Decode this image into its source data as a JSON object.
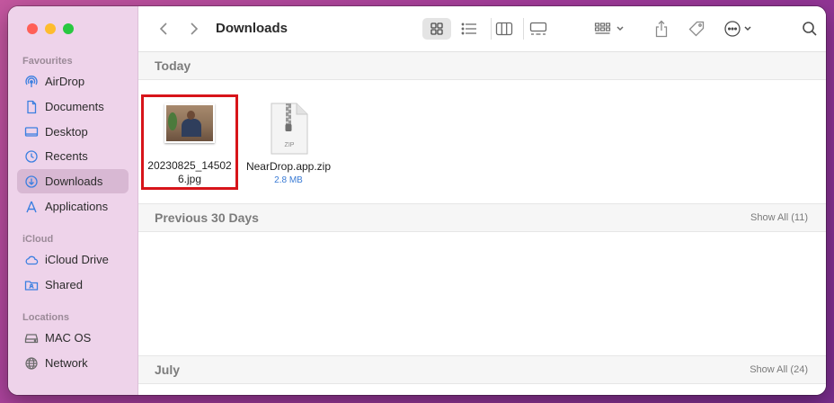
{
  "window": {
    "title": "Downloads"
  },
  "traffic_lights": {
    "close_color": "#ff5f57",
    "minimize_color": "#febc2e",
    "zoom_color": "#28c840"
  },
  "sidebar": {
    "sections": [
      {
        "label": "Favourites",
        "items": [
          {
            "label": "AirDrop",
            "icon": "airdrop-icon"
          },
          {
            "label": "Documents",
            "icon": "document-icon"
          },
          {
            "label": "Desktop",
            "icon": "desktop-icon"
          },
          {
            "label": "Recents",
            "icon": "clock-icon"
          },
          {
            "label": "Downloads",
            "icon": "download-icon",
            "selected": true
          },
          {
            "label": "Applications",
            "icon": "applications-icon"
          }
        ]
      },
      {
        "label": "iCloud",
        "items": [
          {
            "label": "iCloud Drive",
            "icon": "cloud-icon"
          },
          {
            "label": "Shared",
            "icon": "shared-folder-icon"
          }
        ]
      },
      {
        "label": "Locations",
        "items": [
          {
            "label": "MAC OS",
            "icon": "disk-icon"
          },
          {
            "label": "Network",
            "icon": "globe-icon"
          }
        ]
      }
    ]
  },
  "toolbar": {
    "buttons": [
      "back-icon",
      "forward-icon",
      "icon-view-icon",
      "list-view-icon",
      "column-view-icon",
      "gallery-view-icon",
      "group-by-icon",
      "share-icon",
      "tag-icon",
      "more-actions-icon",
      "search-icon"
    ]
  },
  "groups": [
    {
      "title": "Today",
      "files": [
        {
          "name": "20230825_145026.jpg",
          "name_line1": "20230825_14502",
          "name_line2": "6.jpg",
          "type": "image",
          "highlighted": true
        },
        {
          "name": "NearDrop.app.zip",
          "size": "2.8 MB",
          "type": "zip",
          "icon_label": "ZIP"
        }
      ]
    },
    {
      "title": "Previous 30 Days",
      "show_all": "Show All (11)"
    },
    {
      "title": "July",
      "show_all": "Show All (24)"
    }
  ],
  "colors": {
    "accent_selection": "#d8b8d3",
    "highlight_border": "#d7141a",
    "file_size_text": "#3a7bd5"
  }
}
